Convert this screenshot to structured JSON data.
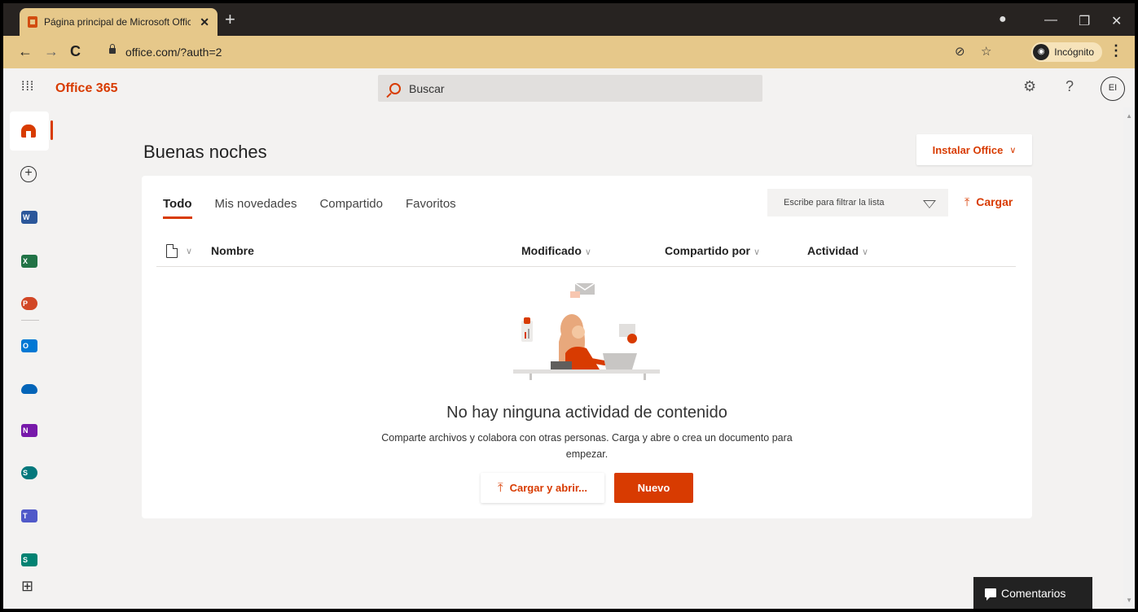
{
  "browser": {
    "tab_title": "Página principal de Microsoft Office",
    "url": "office.com/?auth=2",
    "incognito_label": "Incógnito"
  },
  "header": {
    "brand": "Office 365",
    "search_placeholder": "Buscar",
    "avatar_initials": "EI"
  },
  "rail": {
    "apps": [
      {
        "name": "word",
        "letter": "W",
        "color": "#2b579a"
      },
      {
        "name": "excel",
        "letter": "X",
        "color": "#217346"
      },
      {
        "name": "powerpoint",
        "letter": "P",
        "color": "#d24726"
      },
      {
        "name": "outlook",
        "letter": "O",
        "color": "#0078d4"
      },
      {
        "name": "onedrive",
        "letter": "",
        "color": "#0364b8"
      },
      {
        "name": "onenote",
        "letter": "N",
        "color": "#7719aa"
      },
      {
        "name": "sharepoint",
        "letter": "S",
        "color": "#03787c"
      },
      {
        "name": "teams",
        "letter": "T",
        "color": "#5059c9"
      },
      {
        "name": "sway",
        "letter": "S",
        "color": "#008272"
      }
    ]
  },
  "main": {
    "greeting": "Buenas noches",
    "install_label": "Instalar Office",
    "tabs": [
      "Todo",
      "Mis novedades",
      "Compartido",
      "Favoritos"
    ],
    "filter_placeholder": "Escribe para filtrar la lista",
    "upload_label": "Cargar",
    "columns": {
      "name": "Nombre",
      "modified": "Modificado",
      "shared_by": "Compartido por",
      "activity": "Actividad"
    },
    "empty_title": "No hay ninguna actividad de contenido",
    "empty_subtitle": "Comparte archivos y colabora con otras personas. Carga y abre o crea un documento para empezar.",
    "upload_open_label": "Cargar y abrir...",
    "new_label": "Nuevo"
  },
  "feedback_label": "Comentarios",
  "colors": {
    "accent": "#d83b01",
    "chrome": "#e6c88a"
  }
}
